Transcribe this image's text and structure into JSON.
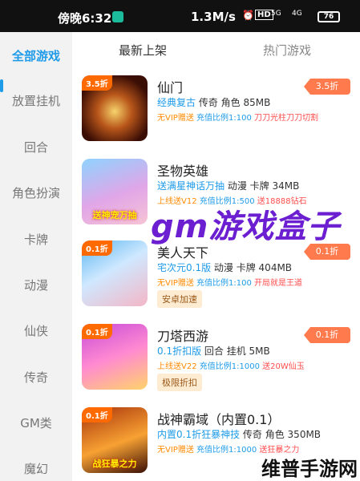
{
  "status_bar": {
    "time": "傍晚6:32",
    "speed": "1.3M/s",
    "hd": "HD",
    "signal_5g": "5G",
    "signal_4g": "4G",
    "battery": "76"
  },
  "sidebar": {
    "items": [
      {
        "label": "全部游戏",
        "active": true
      },
      {
        "label": "放置挂机"
      },
      {
        "label": "回合"
      },
      {
        "label": "角色扮演"
      },
      {
        "label": "卡牌"
      },
      {
        "label": "动漫"
      },
      {
        "label": "仙侠"
      },
      {
        "label": "传奇"
      },
      {
        "label": "GM类"
      },
      {
        "label": "魔幻"
      }
    ]
  },
  "tabs": [
    {
      "label": "最新上架",
      "active": true
    },
    {
      "label": "热门游戏"
    }
  ],
  "games": [
    {
      "name": "仙门",
      "badge": "3.5折",
      "thumb_label": "",
      "tag_hl": "经典复古",
      "tags": "传奇 角色 85MB",
      "vip": "无VIP赠送",
      "rate": "充值比例1:100",
      "gift": "刀刀光柱刀刀切割",
      "discount": "3.5折",
      "button": ""
    },
    {
      "name": "圣物英雄",
      "badge": "",
      "thumb_label": "送神宠万抽",
      "tag_hl": "送满星神话万抽",
      "tags": "动漫 卡牌 34MB",
      "vip": "上线送V12",
      "rate": "充值比例1:500",
      "gift": "送18888钻石",
      "discount": "",
      "button": ""
    },
    {
      "name": "美人天下",
      "badge": "0.1折",
      "thumb_label": "",
      "tag_hl": "宅次元0.1版",
      "tags": "动漫 卡牌 404MB",
      "vip": "无VIP赠送",
      "rate": "充值比例1:100",
      "gift": "开局就是王道",
      "discount": "0.1折",
      "button": "安卓加速"
    },
    {
      "name": "刀塔西游",
      "badge": "0.1折",
      "thumb_label": "",
      "tag_hl": "0.1折扣版",
      "tags": "回合 挂机 5MB",
      "vip": "上线送V22",
      "rate": "充值比例1:1000",
      "gift": "送20W仙玉",
      "discount": "0.1折",
      "button": "极限折扣"
    },
    {
      "name": "战神霸域（内置0.1）",
      "badge": "0.1折",
      "thumb_label": "战狂暴之力",
      "tag_hl": "内置0.1折狂暴神技",
      "tags": "传奇 角色 350MB",
      "vip": "无VIP赠送",
      "rate": "充值比例1:1000",
      "gift": "送狂暴之力",
      "discount": "",
      "button": ""
    }
  ],
  "watermark": "gm游戏盒子",
  "watermark_corner": "维普手游网",
  "colors": {
    "accent": "#1e9be9",
    "discount": "#ff7a4d",
    "vip": "#ff8a00",
    "gift": "#ff4d4d"
  }
}
